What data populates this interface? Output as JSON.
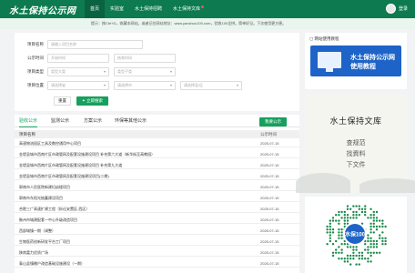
{
  "header": {
    "logo": "水土保持公示网",
    "nav": [
      {
        "label": "首页",
        "active": true,
        "dot": false
      },
      {
        "label": "实验室",
        "active": false,
        "dot": false
      },
      {
        "label": "水土保持招聘",
        "active": false,
        "dot": false
      },
      {
        "label": "水土保持文库",
        "active": false,
        "dot": true
      }
    ],
    "user_label": "登录"
  },
  "tip": "提示：按Ctrl+D，收藏本网站。或者记住网站地址：www.yanshou100.com，验收100全拼。简单好记。下次使用更方便。",
  "search": {
    "project_name_label": "项目名称",
    "project_name_placeholder": "请输入项目名称",
    "date_label": "公示时间",
    "start_placeholder": "开始时间",
    "end_placeholder": "结束时间",
    "type_label": "项目类型",
    "type_big_placeholder": "类型大类",
    "type_small_placeholder": "类型子类",
    "location_label": "项目位置",
    "province_placeholder": "请选择省",
    "city_placeholder": "请选择市",
    "district_placeholder": "请选择县/区",
    "reset_label": "重置",
    "search_label": "立即搜索"
  },
  "list": {
    "tabs": [
      "验收公示",
      "监测公示",
      "方案公示",
      "环保等其他公示"
    ],
    "publish_label": "我要公示",
    "col_name": "项目名称",
    "col_date": "公示时间",
    "rows": [
      {
        "name": "高速物流园区工具及数控通用中心项目",
        "date": "2025-07-15"
      },
      {
        "name": "金堤县城市西南片区市政管网及配套设施建设项目 补充第六大道（新华街至高教园）",
        "date": "2025-07-15"
      },
      {
        "name": "金堤县城市西南片区市政管网及配套设施建设项目 补充第九大道",
        "date": "2025-07-15"
      },
      {
        "name": "金堤县城市西南片区市政管网及配套设施建设项目(二期)",
        "date": "2025-07-15"
      },
      {
        "name": "郭南市人民医院新建妇幼楼项目",
        "date": "2025-07-15"
      },
      {
        "name": "郭南市东阳光抽蓄建设项目",
        "date": "2025-07-15"
      },
      {
        "name": "合肥三广高速扩建工程（拆迁安置区-西区）",
        "date": "2025-07-15"
      },
      {
        "name": "衡州市城建配套一中心升级改造项目",
        "date": "2025-07-15"
      },
      {
        "name": "西部城镇一期（调整）",
        "date": "2025-07-15"
      },
      {
        "name": "生物医药创新研发平台工厂项目",
        "date": "2025-07-15"
      },
      {
        "name": "陕南富力优质广场",
        "date": "2025-07-15"
      },
      {
        "name": "泰山县镇棚户改造基础设施建设（一期）",
        "date": "2025-07-15"
      }
    ]
  },
  "sidebar": {
    "tutorial_title": "网站使用教程",
    "banner_line1": "水土保持公示网",
    "banner_line2": "使用教程",
    "library_title": "水土保持文库",
    "library_lines": [
      "查规范",
      "找資料",
      "下文件"
    ],
    "qr_caption": "水保100"
  },
  "colors": {
    "brand_green": "#0d7a4f",
    "button_green": "#16a05d",
    "banner_blue": "#1e63c7"
  }
}
